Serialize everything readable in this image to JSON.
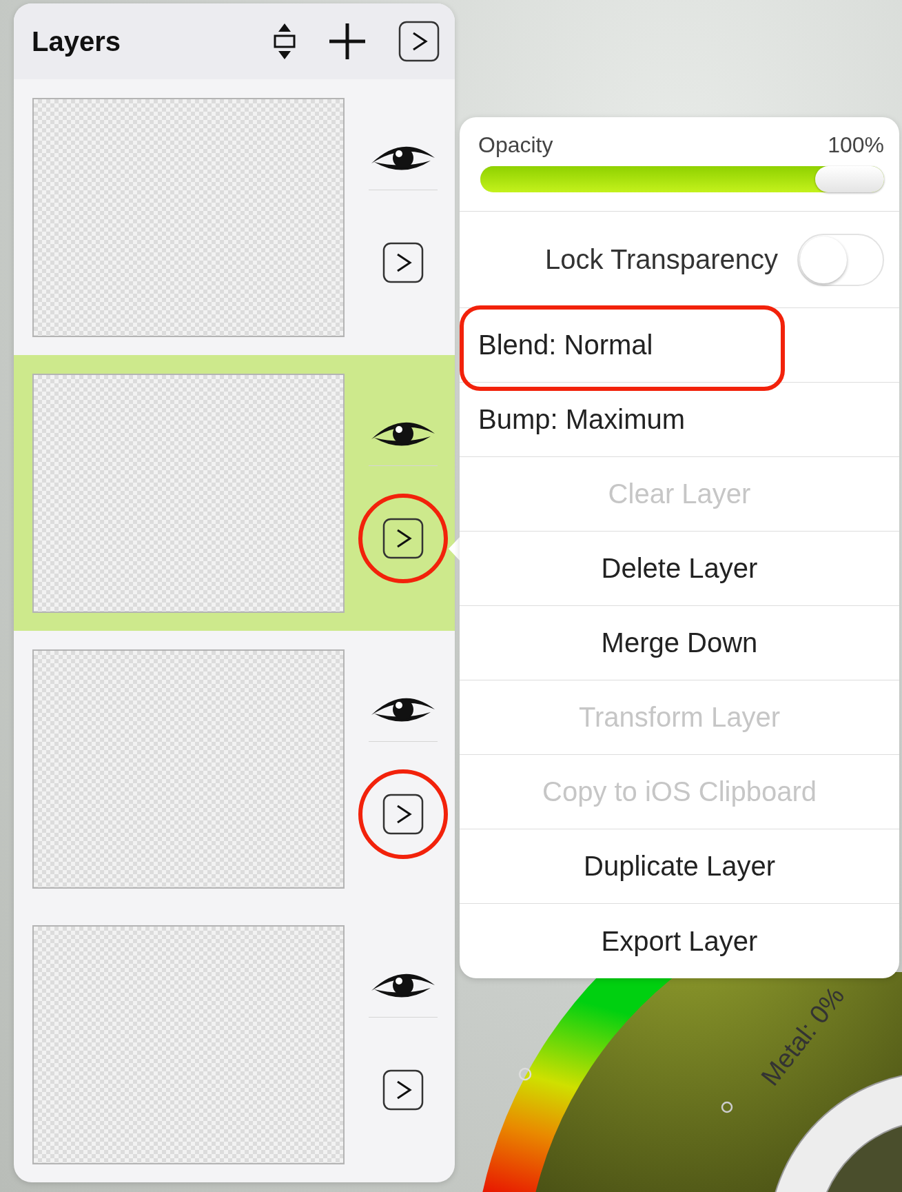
{
  "layers_panel": {
    "title": "Layers",
    "layers": [
      {
        "visible": true,
        "selected": false,
        "annotated": false
      },
      {
        "visible": true,
        "selected": true,
        "annotated": true
      },
      {
        "visible": true,
        "selected": false,
        "annotated": true
      },
      {
        "visible": true,
        "selected": false,
        "annotated": false
      }
    ]
  },
  "layer_menu": {
    "opacity": {
      "label": "Opacity",
      "reading": "100%",
      "level": 1
    },
    "lock_transparency": {
      "label": "Lock Transparency",
      "on": false
    },
    "items": [
      {
        "label": "Blend: Normal",
        "kind": "setting",
        "disabled": false,
        "annotated": true
      },
      {
        "label": "Bump: Maximum",
        "kind": "setting",
        "disabled": false,
        "annotated": false
      },
      {
        "label": "Clear Layer",
        "kind": "action",
        "disabled": true,
        "annotated": false
      },
      {
        "label": "Delete Layer",
        "kind": "action",
        "disabled": false,
        "annotated": false
      },
      {
        "label": "Merge Down",
        "kind": "action",
        "disabled": false,
        "annotated": false
      },
      {
        "label": "Transform Layer",
        "kind": "action",
        "disabled": true,
        "annotated": false
      },
      {
        "label": "Copy to iOS Clipboard",
        "kind": "action",
        "disabled": true,
        "annotated": false
      },
      {
        "label": "Duplicate Layer",
        "kind": "action",
        "disabled": false,
        "annotated": false
      },
      {
        "label": "Export Layer",
        "kind": "action",
        "disabled": false,
        "annotated": false
      }
    ]
  },
  "color_wheel": {
    "metal_label": "Metal: 0%"
  }
}
